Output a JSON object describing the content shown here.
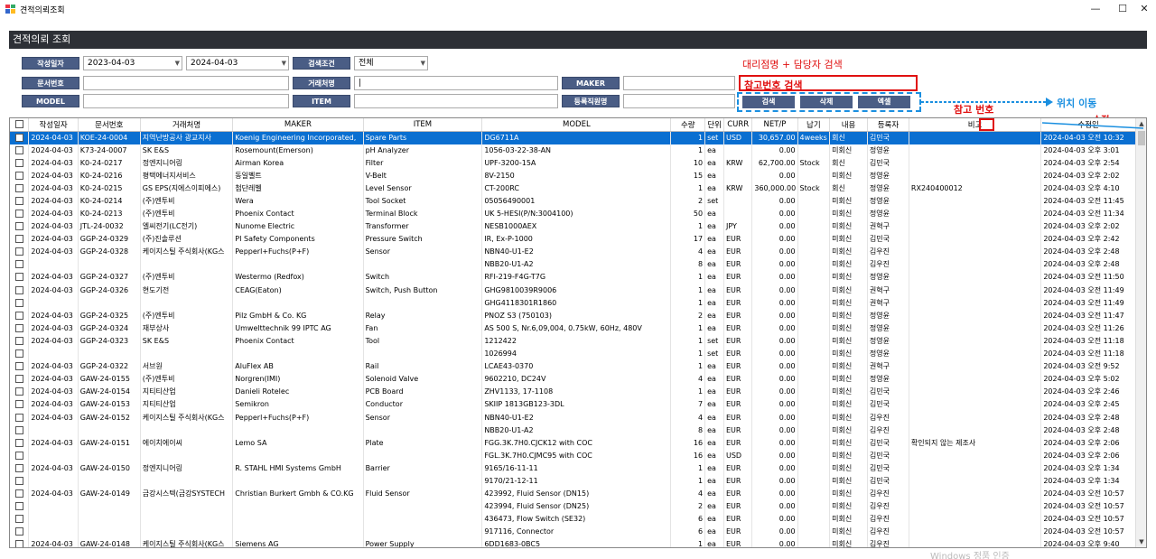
{
  "window": {
    "title": "견적의뢰조회",
    "minimize": "—",
    "maximize": "☐",
    "close": "✕"
  },
  "panel": {
    "title": "견적의뢰 조회"
  },
  "filters": {
    "date_label": "작성일자",
    "date_from": "2023-04-03",
    "date_to": "2024-04-03",
    "condition_label": "검색조건",
    "condition_value": "전체",
    "docno_label": "문서번호",
    "docno_value": "",
    "customer_label": "거래처명",
    "customer_value": "|",
    "maker_label": "MAKER",
    "maker_value": "",
    "model_label": "MODEL",
    "model_value": "",
    "item_label": "ITEM",
    "item_value": "",
    "staff_label": "등록직원명",
    "staff_value": ""
  },
  "buttons": {
    "search": "검색",
    "delete": "삭제",
    "excel": "엑셀"
  },
  "annotations": {
    "agency_search": "대리점명 + 담당자 검색",
    "refno_search": "참고번호 검색",
    "refno": "참고 번호",
    "move": "위치 이동",
    "edit": "수정"
  },
  "grid": {
    "columns": [
      "",
      "작성일자",
      "문서번호",
      "거래처명",
      "MAKER",
      "ITEM",
      "MODEL",
      "수량",
      "단위",
      "CURR",
      "NET/P",
      "납기",
      "내용",
      "등록자",
      "비고",
      "수정일"
    ],
    "rows": [
      {
        "date": "2024-04-03",
        "doc": "KOE-24-0004",
        "cust": "지역난방공사 광교지사",
        "maker": "Koenig Engineering Incorporated,",
        "item": "Spare Parts",
        "model": "DG6711A",
        "qty": "1",
        "unit": "set",
        "curr": "USD",
        "net": "30,657.00",
        "due": "4weeks",
        "content": "회신",
        "reg": "김민국",
        "note": "",
        "mod": "2024-04-03 오전 10:32",
        "sel": true
      },
      {
        "date": "2024-04-03",
        "doc": "K73-24-0007",
        "cust": "SK E&S",
        "maker": "Rosemount(Emerson)",
        "item": "pH Analyzer",
        "model": "1056-03-22-38-AN",
        "qty": "1",
        "unit": "ea",
        "curr": "",
        "net": "0.00",
        "due": "",
        "content": "미회신",
        "reg": "정영윤",
        "note": "",
        "mod": "2024-04-03 오후 3:01"
      },
      {
        "date": "2024-04-03",
        "doc": "K0-24-0217",
        "cust": "정엔지니어링",
        "maker": "Airman Korea",
        "item": "Filter",
        "model": "UPF-3200-15A",
        "qty": "10",
        "unit": "ea",
        "curr": "KRW",
        "net": "62,700.00",
        "due": "Stock",
        "content": "회신",
        "reg": "김민국",
        "note": "",
        "mod": "2024-04-03 오후 2:54"
      },
      {
        "date": "2024-04-03",
        "doc": "K0-24-0216",
        "cust": "평택에너지서비스",
        "maker": "동일벨트",
        "item": "V-Belt",
        "model": "8V-2150",
        "qty": "15",
        "unit": "ea",
        "curr": "",
        "net": "0.00",
        "due": "",
        "content": "미회신",
        "reg": "정영윤",
        "note": "",
        "mod": "2024-04-03 오후 2:02"
      },
      {
        "date": "2024-04-03",
        "doc": "K0-24-0215",
        "cust": "GS EPS(지에스이피에스)",
        "maker": "첨단레벨",
        "item": "Level Sensor",
        "model": "CT-200RC",
        "qty": "1",
        "unit": "ea",
        "curr": "KRW",
        "net": "360,000.00",
        "due": "Stock",
        "content": "회신",
        "reg": "정영윤",
        "note": "RX240400012",
        "mod": "2024-04-03 오후 4:10"
      },
      {
        "date": "2024-04-03",
        "doc": "K0-24-0214",
        "cust": "(주)엔투비",
        "maker": "Wera",
        "item": "Tool Socket",
        "model": "05056490001",
        "qty": "2",
        "unit": "set",
        "curr": "",
        "net": "0.00",
        "due": "",
        "content": "미회신",
        "reg": "정영윤",
        "note": "",
        "mod": "2024-04-03 오전 11:45"
      },
      {
        "date": "2024-04-03",
        "doc": "K0-24-0213",
        "cust": "(주)엔투비",
        "maker": "Phoenix Contact",
        "item": "Terminal Block",
        "model": "UK 5-HESI(P/N:3004100)",
        "qty": "50",
        "unit": "ea",
        "curr": "",
        "net": "0.00",
        "due": "",
        "content": "미회신",
        "reg": "정영윤",
        "note": "",
        "mod": "2024-04-03 오전 11:34"
      },
      {
        "date": "2024-04-03",
        "doc": "JTL-24-0032",
        "cust": "엘씨전기(LC전기)",
        "maker": "Nunome Electric",
        "item": "Transformer",
        "model": "NESB1000AEX",
        "qty": "1",
        "unit": "ea",
        "curr": "JPY",
        "net": "0.00",
        "due": "",
        "content": "미회신",
        "reg": "권혁구",
        "note": "",
        "mod": "2024-04-03 오후 2:02"
      },
      {
        "date": "2024-04-03",
        "doc": "GGP-24-0329",
        "cust": "(주)진솔루션",
        "maker": "PI Safety Components",
        "item": "Pressure Switch",
        "model": "IR, Ex-P-1000",
        "qty": "17",
        "unit": "ea",
        "curr": "EUR",
        "net": "0.00",
        "due": "",
        "content": "미회신",
        "reg": "김민국",
        "note": "",
        "mod": "2024-04-03 오후 2:42"
      },
      {
        "date": "2024-04-03",
        "doc": "GGP-24-0328",
        "cust": "케이지스틸 주식회사(KG스",
        "maker": "Pepperl+Fuchs(P+F)",
        "item": "Sensor",
        "model": "NBN40-U1-E2",
        "qty": "4",
        "unit": "ea",
        "curr": "EUR",
        "net": "0.00",
        "due": "",
        "content": "미회신",
        "reg": "김우진",
        "note": "",
        "mod": "2024-04-03 오후 2:48"
      },
      {
        "date": "",
        "doc": "",
        "cust": "",
        "maker": "",
        "item": "",
        "model": "NBB20-U1-A2",
        "qty": "8",
        "unit": "ea",
        "curr": "EUR",
        "net": "0.00",
        "due": "",
        "content": "미회신",
        "reg": "김우진",
        "note": "",
        "mod": "2024-04-03 오후 2:48"
      },
      {
        "date": "2024-04-03",
        "doc": "GGP-24-0327",
        "cust": "(주)엔투비",
        "maker": "Westermo (Redfox)",
        "item": "Switch",
        "model": "RFI-219-F4G-T7G",
        "qty": "1",
        "unit": "ea",
        "curr": "EUR",
        "net": "0.00",
        "due": "",
        "content": "미회신",
        "reg": "정영윤",
        "note": "",
        "mod": "2024-04-03 오전 11:50"
      },
      {
        "date": "2024-04-03",
        "doc": "GGP-24-0326",
        "cust": "현도기전",
        "maker": "CEAG(Eaton)",
        "item": "Switch, Push Button",
        "model": "GHG9810039R9006",
        "qty": "1",
        "unit": "ea",
        "curr": "EUR",
        "net": "0.00",
        "due": "",
        "content": "미회신",
        "reg": "권혁구",
        "note": "",
        "mod": "2024-04-03 오전 11:49"
      },
      {
        "date": "",
        "doc": "",
        "cust": "",
        "maker": "",
        "item": "",
        "model": "GHG4118301R1860",
        "qty": "1",
        "unit": "ea",
        "curr": "EUR",
        "net": "0.00",
        "due": "",
        "content": "미회신",
        "reg": "권혁구",
        "note": "",
        "mod": "2024-04-03 오전 11:49"
      },
      {
        "date": "2024-04-03",
        "doc": "GGP-24-0325",
        "cust": "(주)엔투비",
        "maker": "Pilz GmbH & Co. KG",
        "item": "Relay",
        "model": "PNOZ S3 (750103)",
        "qty": "2",
        "unit": "ea",
        "curr": "EUR",
        "net": "0.00",
        "due": "",
        "content": "미회신",
        "reg": "정영윤",
        "note": "",
        "mod": "2024-04-03 오전 11:47"
      },
      {
        "date": "2024-04-03",
        "doc": "GGP-24-0324",
        "cust": "재부상사",
        "maker": "Umwelttechnik 99 IPTC AG",
        "item": "Fan",
        "model": "AS 500 S, Nr.6,09,004, 0.75kW, 60Hz, 480V",
        "qty": "1",
        "unit": "ea",
        "curr": "EUR",
        "net": "0.00",
        "due": "",
        "content": "미회신",
        "reg": "정영윤",
        "note": "",
        "mod": "2024-04-03 오전 11:26"
      },
      {
        "date": "2024-04-03",
        "doc": "GGP-24-0323",
        "cust": "SK E&S",
        "maker": "Phoenix Contact",
        "item": "Tool",
        "model": "1212422",
        "qty": "1",
        "unit": "set",
        "curr": "EUR",
        "net": "0.00",
        "due": "",
        "content": "미회신",
        "reg": "정영윤",
        "note": "",
        "mod": "2024-04-03 오전 11:18"
      },
      {
        "date": "",
        "doc": "",
        "cust": "",
        "maker": "",
        "item": "",
        "model": "1026994",
        "qty": "1",
        "unit": "set",
        "curr": "EUR",
        "net": "0.00",
        "due": "",
        "content": "미회신",
        "reg": "정영윤",
        "note": "",
        "mod": "2024-04-03 오전 11:18"
      },
      {
        "date": "2024-04-03",
        "doc": "GGP-24-0322",
        "cust": "서브원",
        "maker": "AluFlex AB",
        "item": "Rail",
        "model": "LCAE43-0370",
        "qty": "1",
        "unit": "ea",
        "curr": "EUR",
        "net": "0.00",
        "due": "",
        "content": "미회신",
        "reg": "권혁구",
        "note": "",
        "mod": "2024-04-03 오전 9:52"
      },
      {
        "date": "2024-04-03",
        "doc": "GAW-24-0155",
        "cust": "(주)엔투비",
        "maker": "Norgren(IMI)",
        "item": "Solenoid Valve",
        "model": "9602210, DC24V",
        "qty": "4",
        "unit": "ea",
        "curr": "EUR",
        "net": "0.00",
        "due": "",
        "content": "미회신",
        "reg": "정영윤",
        "note": "",
        "mod": "2024-04-03 오후 5:02"
      },
      {
        "date": "2024-04-03",
        "doc": "GAW-24-0154",
        "cust": "지티티산업",
        "maker": "Danieli Rotelec",
        "item": "PCB Board",
        "model": "ZHV1133, 17-1108",
        "qty": "1",
        "unit": "ea",
        "curr": "EUR",
        "net": "0.00",
        "due": "",
        "content": "미회신",
        "reg": "김민국",
        "note": "",
        "mod": "2024-04-03 오후 2:46"
      },
      {
        "date": "2024-04-03",
        "doc": "GAW-24-0153",
        "cust": "지티티산업",
        "maker": "Semikron",
        "item": "Conductor",
        "model": "SKIIP 1813GB123-3DL",
        "qty": "7",
        "unit": "ea",
        "curr": "EUR",
        "net": "0.00",
        "due": "",
        "content": "미회신",
        "reg": "김민국",
        "note": "",
        "mod": "2024-04-03 오후 2:45"
      },
      {
        "date": "2024-04-03",
        "doc": "GAW-24-0152",
        "cust": "케이지스틸 주식회사(KG스",
        "maker": "Pepperl+Fuchs(P+F)",
        "item": "Sensor",
        "model": "NBN40-U1-E2",
        "qty": "4",
        "unit": "ea",
        "curr": "EUR",
        "net": "0.00",
        "due": "",
        "content": "미회신",
        "reg": "김우진",
        "note": "",
        "mod": "2024-04-03 오후 2:48"
      },
      {
        "date": "",
        "doc": "",
        "cust": "",
        "maker": "",
        "item": "",
        "model": "NBB20-U1-A2",
        "qty": "8",
        "unit": "ea",
        "curr": "EUR",
        "net": "0.00",
        "due": "",
        "content": "미회신",
        "reg": "김우진",
        "note": "",
        "mod": "2024-04-03 오후 2:48"
      },
      {
        "date": "2024-04-03",
        "doc": "GAW-24-0151",
        "cust": "에이치에이씨",
        "maker": "Lemo SA",
        "item": "Plate",
        "model": "FGG.3K.7H0.CJCK12 with COC",
        "qty": "16",
        "unit": "ea",
        "curr": "EUR",
        "net": "0.00",
        "due": "",
        "content": "미회신",
        "reg": "김민국",
        "note": "확인되지 않는 제조사",
        "mod": "2024-04-03 오후 2:06"
      },
      {
        "date": "",
        "doc": "",
        "cust": "",
        "maker": "",
        "item": "",
        "model": "FGL.3K.7H0.CJMC95 with COC",
        "qty": "16",
        "unit": "ea",
        "curr": "USD",
        "net": "0.00",
        "due": "",
        "content": "미회신",
        "reg": "김민국",
        "note": "",
        "mod": "2024-04-03 오후 2:06"
      },
      {
        "date": "2024-04-03",
        "doc": "GAW-24-0150",
        "cust": "정엔지니어링",
        "maker": "R. STAHL HMI Systems GmbH",
        "item": "Barrier",
        "model": "9165/16-11-11",
        "qty": "1",
        "unit": "ea",
        "curr": "EUR",
        "net": "0.00",
        "due": "",
        "content": "미회신",
        "reg": "김민국",
        "note": "",
        "mod": "2024-04-03 오후 1:34"
      },
      {
        "date": "",
        "doc": "",
        "cust": "",
        "maker": "",
        "item": "",
        "model": "9170/21-12-11",
        "qty": "1",
        "unit": "ea",
        "curr": "EUR",
        "net": "0.00",
        "due": "",
        "content": "미회신",
        "reg": "김민국",
        "note": "",
        "mod": "2024-04-03 오후 1:34"
      },
      {
        "date": "2024-04-03",
        "doc": "GAW-24-0149",
        "cust": "금강시스텍(금강SYSTECH",
        "maker": "Christian Burkert Gmbh & CO.KG",
        "item": "Fluid Sensor",
        "model": "423992, Fluid Sensor (DN15)",
        "qty": "4",
        "unit": "ea",
        "curr": "EUR",
        "net": "0.00",
        "due": "",
        "content": "미회신",
        "reg": "김우진",
        "note": "",
        "mod": "2024-04-03 오전 10:57"
      },
      {
        "date": "",
        "doc": "",
        "cust": "",
        "maker": "",
        "item": "",
        "model": "423994, Fluid Sensor (DN25)",
        "qty": "2",
        "unit": "ea",
        "curr": "EUR",
        "net": "0.00",
        "due": "",
        "content": "미회신",
        "reg": "김우진",
        "note": "",
        "mod": "2024-04-03 오전 10:57"
      },
      {
        "date": "",
        "doc": "",
        "cust": "",
        "maker": "",
        "item": "",
        "model": "436473, Flow Switch (SE32)",
        "qty": "6",
        "unit": "ea",
        "curr": "EUR",
        "net": "0.00",
        "due": "",
        "content": "미회신",
        "reg": "김우진",
        "note": "",
        "mod": "2024-04-03 오전 10:57"
      },
      {
        "date": "",
        "doc": "",
        "cust": "",
        "maker": "",
        "item": "",
        "model": "917116, Connector",
        "qty": "6",
        "unit": "ea",
        "curr": "EUR",
        "net": "0.00",
        "due": "",
        "content": "미회신",
        "reg": "김우진",
        "note": "",
        "mod": "2024-04-03 오전 10:57"
      },
      {
        "date": "2024-04-03",
        "doc": "GAW-24-0148",
        "cust": "케이지스틸 주식회사(KG스",
        "maker": "Siemens AG",
        "item": "Power Supply",
        "model": "6DD1683-0BC5",
        "qty": "1",
        "unit": "ea",
        "curr": "EUR",
        "net": "0.00",
        "due": "",
        "content": "미회신",
        "reg": "김우진",
        "note": "",
        "mod": "2024-04-03 오후 9:40"
      }
    ]
  },
  "watermark": "Windows 정품 인증",
  "colors": {
    "header_bg": "#2d3036",
    "label_bg": "#4a5d85",
    "selected_row": "#0a6fd1",
    "annotation": "#e01010",
    "annotation_blue": "#1a8fe0"
  }
}
